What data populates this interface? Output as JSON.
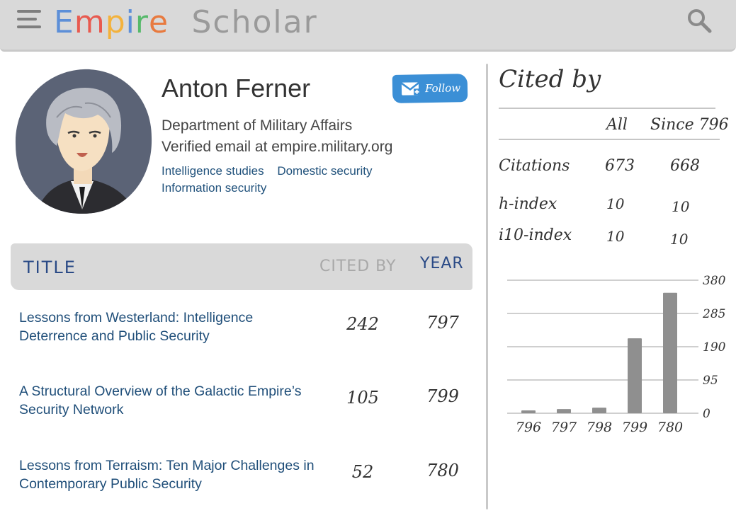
{
  "header": {
    "brand": {
      "word1_letters": [
        {
          "ch": "E",
          "color": "#5d8fd8"
        },
        {
          "ch": "m",
          "color": "#e85a4f"
        },
        {
          "ch": "p",
          "color": "#f3b23c"
        },
        {
          "ch": "i",
          "color": "#5d8fd8"
        },
        {
          "ch": "r",
          "color": "#56b96a"
        },
        {
          "ch": "e",
          "color": "#e87a3f"
        }
      ],
      "word2": "Scholar"
    },
    "menu_icon": "hamburger-icon",
    "search_icon": "search-icon"
  },
  "profile": {
    "name": "Anton Ferner",
    "follow_label": "Follow",
    "affiliation": "Department of Military Affairs",
    "email": "Verified email at empire.military.org",
    "interests": [
      "Intelligence studies",
      "Domestic security",
      "Information security"
    ]
  },
  "publications": {
    "headers": {
      "title": "TITLE",
      "cited_by": "CITED BY",
      "year": "YEAR"
    },
    "rows": [
      {
        "title": "Lessons from Westerland: Intelligence Deterrence and Public Security",
        "cited_by": "242",
        "year": "797"
      },
      {
        "title": "A Structural Overview of the Galactic Empire’s Security Network",
        "cited_by": "105",
        "year": "799"
      },
      {
        "title": "Lessons from Terraism: Ten Major Challenges in Contemporary Public Security",
        "cited_by": "52",
        "year": "780"
      }
    ]
  },
  "cited_by": {
    "title": "Cited by",
    "col_all": "All",
    "col_since": "Since 796",
    "metrics": [
      {
        "label": "Citations",
        "all": "673",
        "since": "668"
      },
      {
        "label": "h-index",
        "all": "10",
        "since": "10"
      },
      {
        "label": "i10-index",
        "all": "10",
        "since": "10"
      }
    ]
  },
  "chart_data": {
    "type": "bar",
    "categories": [
      "796",
      "797",
      "798",
      "799",
      "780"
    ],
    "values": [
      8,
      12,
      16,
      214,
      344
    ],
    "ylim": [
      0,
      380
    ],
    "yticks": [
      "380",
      "285",
      "190",
      "95",
      "0"
    ],
    "ytick_values": [
      380,
      285,
      190,
      95,
      0
    ],
    "bar_color": "#8f8f8f",
    "grid": true
  }
}
